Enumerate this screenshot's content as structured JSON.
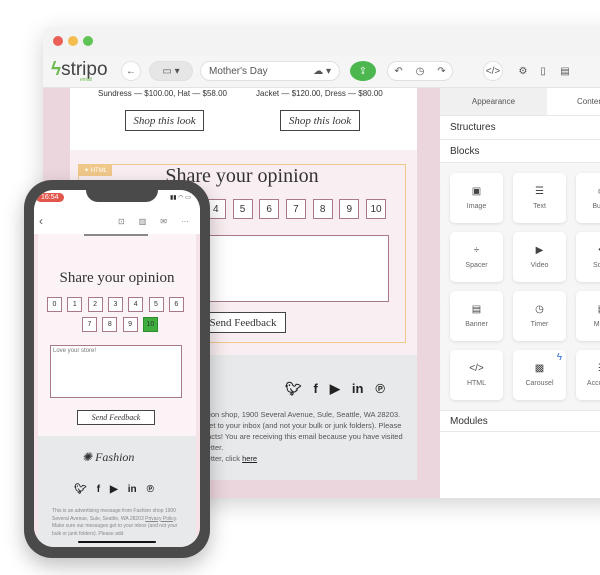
{
  "toolbar": {
    "logo": "stripo",
    "logo_sub": "email",
    "template_name": "Mother's Day"
  },
  "colors": {
    "accent_green": "#4cb74f",
    "canvas_pink": "#ecd6dd",
    "html_border": "#f0c88a",
    "selected_score": "#3fae3f"
  },
  "email": {
    "products": [
      "Sundress — $100.00, Hat — $58.00",
      "Jacket — $120.00, Dress — $80.00"
    ],
    "shop_label": "Shop this look",
    "html_badge": "✦ HTML",
    "title": "Share your opinion",
    "scores": [
      "0",
      "1",
      "2",
      "3",
      "4",
      "5",
      "6",
      "7",
      "8",
      "9",
      "10"
    ],
    "selected_score": "10",
    "send_label": "Send Feedback",
    "footer_lines": [
      "hion shop, 1900 Several Avenue, Sule, Seattle, WA 28203.",
      "get to your inbox (and not your bulk or junk folders). Please",
      "tacts! You are receiving this email because you have visited",
      "letter.",
      "letter, click "
    ],
    "footer_link": "here"
  },
  "panel": {
    "tabs": [
      "Appearance",
      "Content"
    ],
    "sections": [
      "Structures",
      "Blocks",
      "Modules"
    ],
    "blocks": [
      {
        "label": "Image",
        "icon": "image-icon"
      },
      {
        "label": "Text",
        "icon": "text-icon"
      },
      {
        "label": "Button",
        "icon": "button-icon"
      },
      {
        "label": "Spacer",
        "icon": "spacer-icon"
      },
      {
        "label": "Video",
        "icon": "video-icon"
      },
      {
        "label": "Social",
        "icon": "social-icon"
      },
      {
        "label": "Banner",
        "icon": "banner-icon"
      },
      {
        "label": "Timer",
        "icon": "timer-icon"
      },
      {
        "label": "Menu",
        "icon": "menu-icon"
      },
      {
        "label": "HTML",
        "icon": "code-icon"
      },
      {
        "label": "Carousel",
        "icon": "carousel-icon"
      },
      {
        "label": "Accordion",
        "icon": "accordion-icon"
      }
    ]
  },
  "phone": {
    "time": "16:54",
    "feedback_text": "Love your store!",
    "brand": "Fashion",
    "footer_text": "This is an advertising message from Fashion shop 1900 Several Avenue, Sule, Seattle, WA 28203",
    "privacy": "Privacy Policy",
    "footer_text2": ". Make sure our messages get to your inbox (and not your bulk or junk folders). Please add"
  }
}
